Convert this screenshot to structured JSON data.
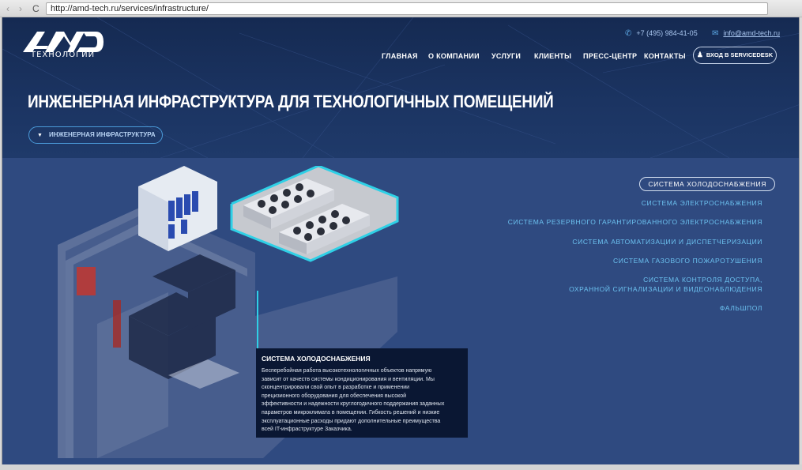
{
  "browser": {
    "url": "http://amd-tech.ru/services/infrastructure/",
    "back_icon": "‹",
    "fwd_icon": "›",
    "reload_icon": "C"
  },
  "header": {
    "logo_text": "AMD",
    "logo_sub": "ТЕХНОЛОГИИ",
    "phone": "+7 (495) 984-41-05",
    "email": "info@amd-tech.ru",
    "nav": [
      "ГЛАВНАЯ",
      "О КОМПАНИИ",
      "УСЛУГИ",
      "КЛИЕНТЫ",
      "ПРЕСС-ЦЕНТР",
      "КОНТАКТЫ"
    ],
    "servicedesk": "ВХОД В SERVICEDESK"
  },
  "hero": {
    "title": "ИНЖЕНЕРНАЯ ИНФРАСТРУКТУРА ДЛЯ ТЕХНОЛОГИЧНЫХ ПОМЕЩЕНИЙ",
    "dropdown_label": "ИНЖЕНЕРНАЯ ИНФРАСТРУКТУРА"
  },
  "systems": [
    "СИСТЕМА ХОЛОДОСНАБЖЕНИЯ",
    "СИСТЕМА ЭЛЕКТРОСНАБЖЕНИЯ",
    "СИСТЕМА РЕЗЕРВНОГО ГАРАНТИРОВАННОГО ЭЛЕКТРОСНАБЖЕНИЯ",
    "СИСТЕМА АВТОМАТИЗАЦИИ И ДИСПЕТЧЕРИЗАЦИИ",
    "СИСТЕМА ГАЗОВОГО ПОЖАРОТУШЕНИЯ",
    "СИСТЕМА КОНТРОЛЯ ДОСТУПА,",
    "ОХРАННОЙ СИГНАЛИЗАЦИИ И ВИДЕОНАБЛЮДЕНИЯ",
    "ФАЛЬШПОЛ"
  ],
  "info": {
    "title": "СИСТЕМА ХОЛОДОСНАБЖЕНИЯ",
    "lines": [
      "Бесперебойная работа высокотехнологичных объектов напрямую",
      "зависит от качеств системы кондиционирования и вентиляции. Мы",
      "сконцентрировали свой опыт в разработке и применении",
      "прецизионного оборудования для обеспечения высокой",
      "эффективности и надежности круглогодичного поддержания заданных",
      "параметров микроклимата в помещении. Гибкость решений и низкие",
      "эксплуатационные расходы придают дополнительные преимущества",
      "всей IT-инфраструктуре Заказчика."
    ]
  },
  "colors": {
    "hero_bg": "#1b3462",
    "main_bg": "#2f4a80",
    "link": "#6cc2f0",
    "accent_cyan": "#2fd0e6",
    "info_bg": "#0a1733"
  }
}
